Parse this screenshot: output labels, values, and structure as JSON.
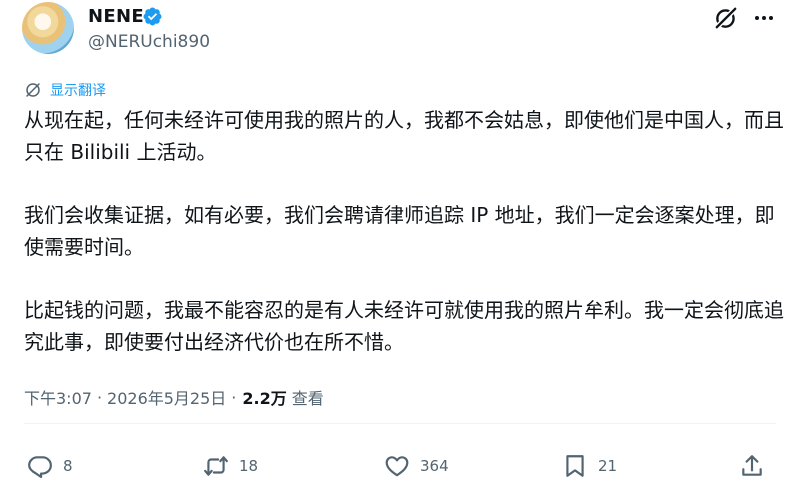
{
  "author": {
    "name": "NENE",
    "handle": "@NERUchi890"
  },
  "translate": {
    "label": "显示翻译"
  },
  "post": {
    "paragraphs": [
      "从现在起，任何未经许可使用我的照片的人，我都不会姑息，即使他们是中国人，而且只在 Bilibili 上活动。",
      "我们会收集证据，如有必要，我们会聘请律师追踪 IP 地址，我们一定会逐案处理，即使需要时间。",
      "比起钱的问题，我最不能容忍的是有人未经许可就使用我的照片牟利。我一定会彻底追究此事，即使要付出经济代价也在所不惜。"
    ],
    "time": "下午3:07",
    "separator1": "·",
    "date": "2026年5月25日",
    "separator2": "·",
    "views": "2.2万",
    "views_label": "查看"
  },
  "actions": {
    "replies": "8",
    "reposts": "18",
    "likes": "364",
    "bookmarks": "21"
  },
  "colors": {
    "accent": "#1d9bf0",
    "text_primary": "#0f1419",
    "text_secondary": "#536471"
  },
  "icons": [
    "verified-badge-icon",
    "grok-icon",
    "more-icon",
    "translate-icon",
    "reply-icon",
    "repost-icon",
    "like-icon",
    "bookmark-icon",
    "share-icon"
  ]
}
